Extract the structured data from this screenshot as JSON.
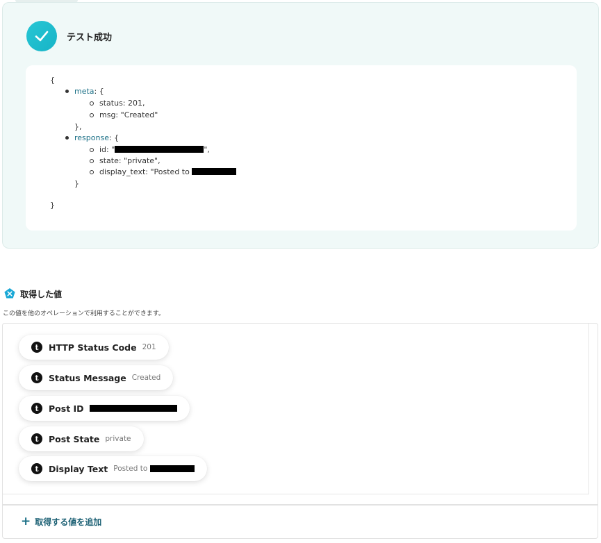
{
  "success": {
    "title": "テスト成功",
    "icon": "check-icon"
  },
  "json_output": {
    "open_brace": "{",
    "close_brace": "}",
    "meta": {
      "key": "meta",
      "open": ": {",
      "status": "status: 201,",
      "msg": "msg: \"Created\"",
      "close": "},"
    },
    "response": {
      "key": "response",
      "open": ": {",
      "id_prefix": "id: \"",
      "id_suffix": "\",",
      "state": "state: \"private\",",
      "display_text_prefix": "display_text: \"Posted to ",
      "close": "}"
    }
  },
  "acquired": {
    "title": "取得した値",
    "description": "この値を他のオペレーションで利用することができます。",
    "items": [
      {
        "label": "HTTP Status Code",
        "value": "201"
      },
      {
        "label": "Status Message",
        "value": "Created"
      },
      {
        "label": "Post ID",
        "value": ""
      },
      {
        "label": "Post State",
        "value": "private"
      },
      {
        "label": "Display Text",
        "value": "Posted to "
      }
    ],
    "add_label": "取得する値を追加"
  },
  "colors": {
    "accent": "#1a6f86",
    "success": "#1fbfd0",
    "panel_bg": "#f0f9f8"
  }
}
